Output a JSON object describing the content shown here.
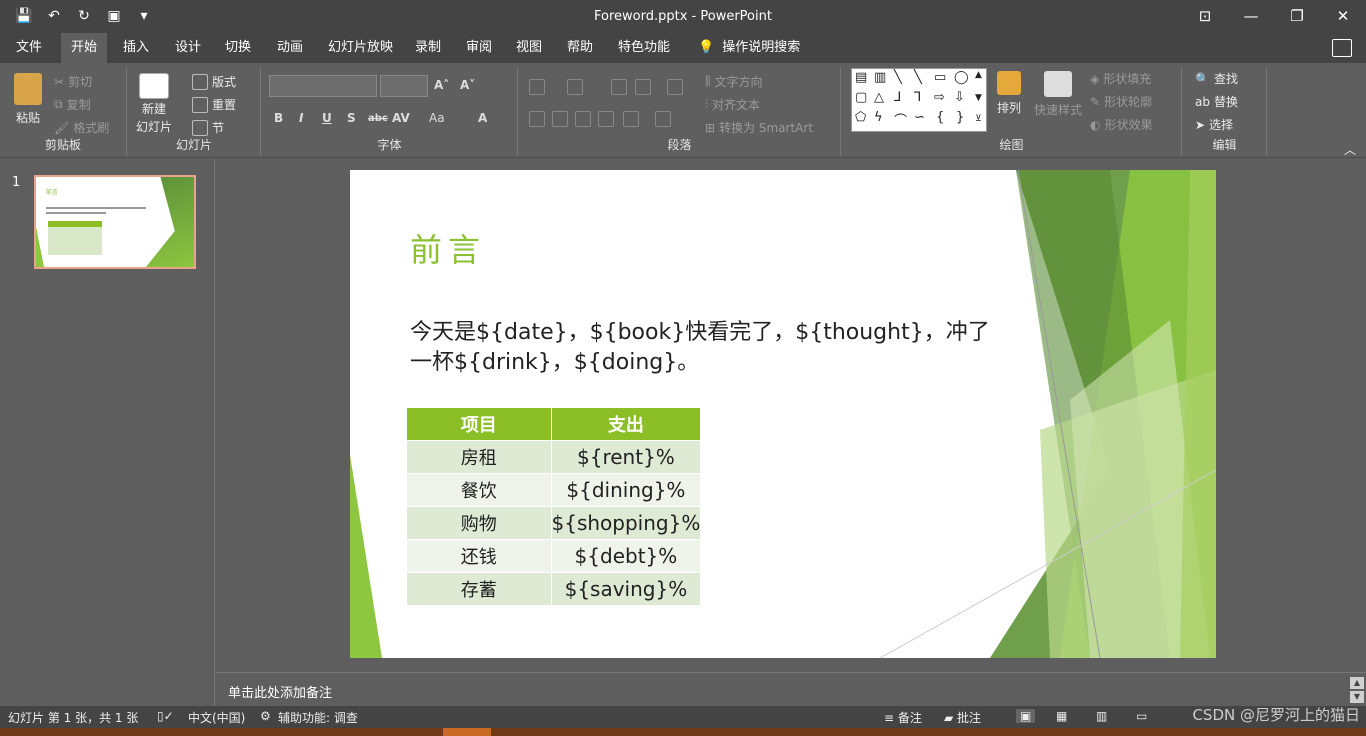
{
  "window": {
    "title": "Foreword.pptx  -  PowerPoint",
    "qat": [
      "save-icon",
      "undo-icon",
      "redo-icon",
      "present-icon",
      "customize-icon"
    ]
  },
  "tabs": [
    "文件",
    "开始",
    "插入",
    "设计",
    "切换",
    "动画",
    "幻灯片放映",
    "录制",
    "审阅",
    "视图",
    "帮助",
    "特色功能"
  ],
  "active_tab": "开始",
  "tell_me": "操作说明搜索",
  "ribbon": {
    "clipboard": {
      "paste": "粘贴",
      "cut": "剪切",
      "copy": "复制",
      "format_painter": "格式刷",
      "label": "剪贴板"
    },
    "slides": {
      "new_slide_1": "新建",
      "new_slide_2": "幻灯片",
      "layout": "版式",
      "reset": "重置",
      "section": "节",
      "label": "幻灯片"
    },
    "font": {
      "label": "字体",
      "buttons": [
        "B",
        "I",
        "U",
        "S",
        "abc",
        "AV",
        "Aa",
        "A"
      ]
    },
    "paragraph": {
      "label": "段落",
      "text_direction": "文字方向",
      "align_text": "对齐文本",
      "convert_smartart": "转换为 SmartArt"
    },
    "drawing": {
      "label": "绘图",
      "arrange": "排列",
      "quick_styles": "快速样式",
      "shape_fill": "形状填充",
      "shape_outline": "形状轮廓",
      "shape_effects": "形状效果"
    },
    "editing": {
      "label": "编辑",
      "find": "查找",
      "replace": "替换",
      "select": "选择"
    }
  },
  "thumb": {
    "number": "1",
    "title": "前言"
  },
  "slide": {
    "title": "前言",
    "body": "今天是${date}，${book}快看完了，${thought}，冲了一杯${drink}，${doing}。",
    "table": {
      "headers": [
        "项目",
        "支出"
      ],
      "rows": [
        [
          "房租",
          "${rent}%"
        ],
        [
          "餐饮",
          "${dining}%"
        ],
        [
          "购物",
          "${shopping}%"
        ],
        [
          "还钱",
          "${debt}%"
        ],
        [
          "存蓄",
          "${saving}%"
        ]
      ]
    },
    "accent": "#8cbf26"
  },
  "notes": {
    "placeholder": "单击此处添加备注"
  },
  "status": {
    "slide_info": "幻灯片 第 1 张，共 1 张",
    "language": "中文(中国)",
    "accessibility": "辅助功能: 调查",
    "notes_btn": "备注",
    "comments_btn": "批注"
  },
  "watermark": "CSDN @尼罗河上的猫日"
}
